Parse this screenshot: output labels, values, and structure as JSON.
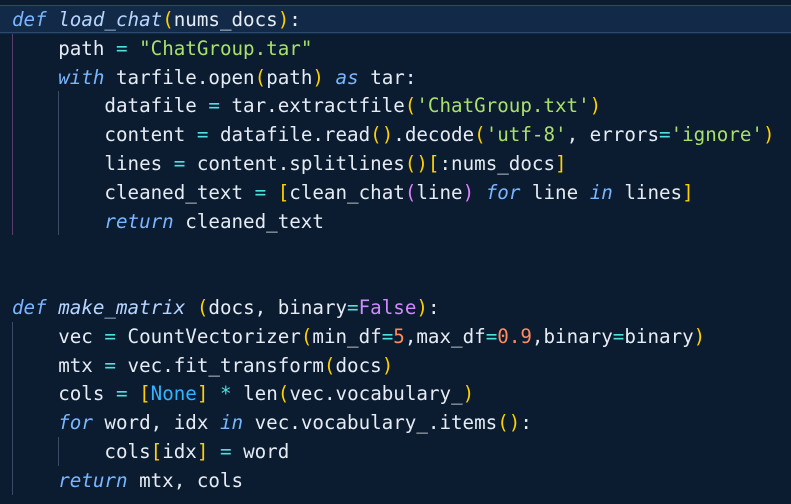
{
  "editor": {
    "colors": {
      "background": "#0b1b30",
      "keyword": "#7ab6ff",
      "string": "#a8e06b",
      "operator": "#4ee1e1",
      "number": "#ff8a5c",
      "constant": "#cf8aff",
      "bracket_yellow": "#ffd000",
      "bracket_purple": "#e080ff",
      "bracket_blue": "#33b4ff"
    },
    "lines": [
      [
        [
          "kw",
          "def"
        ],
        [
          "plain",
          " "
        ],
        [
          "fn",
          "load_chat"
        ],
        [
          "y",
          "("
        ],
        [
          "plain",
          "nums_docs"
        ],
        [
          "y",
          ")"
        ],
        [
          "punc",
          ":"
        ]
      ],
      [
        [
          "plain",
          "    path "
        ],
        [
          "op",
          "="
        ],
        [
          "plain",
          " "
        ],
        [
          "str",
          "\"ChatGroup.tar\""
        ]
      ],
      [
        [
          "plain",
          "    "
        ],
        [
          "kw",
          "with"
        ],
        [
          "plain",
          " tarfile.open"
        ],
        [
          "y",
          "("
        ],
        [
          "plain",
          "path"
        ],
        [
          "y",
          ")"
        ],
        [
          "plain",
          " "
        ],
        [
          "kw",
          "as"
        ],
        [
          "plain",
          " tar:"
        ]
      ],
      [
        [
          "plain",
          "        datafile "
        ],
        [
          "op",
          "="
        ],
        [
          "plain",
          " tar.extractfile"
        ],
        [
          "y",
          "("
        ],
        [
          "str",
          "'ChatGroup.txt'"
        ],
        [
          "y",
          ")"
        ]
      ],
      [
        [
          "plain",
          "        content "
        ],
        [
          "op",
          "="
        ],
        [
          "plain",
          " datafile.read"
        ],
        [
          "y",
          "("
        ],
        [
          "y",
          ")"
        ],
        [
          "plain",
          ".decode"
        ],
        [
          "y",
          "("
        ],
        [
          "str",
          "'utf-8'"
        ],
        [
          "plain",
          ", errors"
        ],
        [
          "op",
          "="
        ],
        [
          "str",
          "'ignore'"
        ],
        [
          "y",
          ")"
        ]
      ],
      [
        [
          "plain",
          "        lines "
        ],
        [
          "op",
          "="
        ],
        [
          "plain",
          " content.splitlines"
        ],
        [
          "y",
          "("
        ],
        [
          "y",
          ")"
        ],
        [
          "y",
          "["
        ],
        [
          "plain",
          ":nums_docs"
        ],
        [
          "y",
          "]"
        ]
      ],
      [
        [
          "plain",
          "        cleaned_text "
        ],
        [
          "op",
          "="
        ],
        [
          "plain",
          " "
        ],
        [
          "y",
          "["
        ],
        [
          "plain",
          "clean_chat"
        ],
        [
          "p",
          "("
        ],
        [
          "plain",
          "line"
        ],
        [
          "p",
          ")"
        ],
        [
          "plain",
          " "
        ],
        [
          "kw",
          "for"
        ],
        [
          "plain",
          " line "
        ],
        [
          "kw",
          "in"
        ],
        [
          "plain",
          " lines"
        ],
        [
          "y",
          "]"
        ]
      ],
      [
        [
          "plain",
          "        "
        ],
        [
          "kw",
          "return"
        ],
        [
          "plain",
          " cleaned_text"
        ]
      ],
      [],
      [],
      [
        [
          "kw",
          "def"
        ],
        [
          "plain",
          " "
        ],
        [
          "fn",
          "make_matrix"
        ],
        [
          "plain",
          " "
        ],
        [
          "y",
          "("
        ],
        [
          "plain",
          "docs, binary"
        ],
        [
          "op",
          "="
        ],
        [
          "const",
          "False"
        ],
        [
          "y",
          ")"
        ],
        [
          "punc",
          ":"
        ]
      ],
      [
        [
          "plain",
          "    vec "
        ],
        [
          "op",
          "="
        ],
        [
          "plain",
          " CountVectorizer"
        ],
        [
          "y",
          "("
        ],
        [
          "plain",
          "min_df"
        ],
        [
          "op",
          "="
        ],
        [
          "num",
          "5"
        ],
        [
          "plain",
          ",max_df"
        ],
        [
          "op",
          "="
        ],
        [
          "num",
          "0.9"
        ],
        [
          "plain",
          ",binary"
        ],
        [
          "op",
          "="
        ],
        [
          "plain",
          "binary"
        ],
        [
          "y",
          ")"
        ]
      ],
      [
        [
          "plain",
          "    mtx "
        ],
        [
          "op",
          "="
        ],
        [
          "plain",
          " vec.fit_transform"
        ],
        [
          "y",
          "("
        ],
        [
          "plain",
          "docs"
        ],
        [
          "y",
          ")"
        ]
      ],
      [
        [
          "plain",
          "    cols "
        ],
        [
          "op",
          "="
        ],
        [
          "plain",
          " "
        ],
        [
          "y",
          "["
        ],
        [
          "b",
          "None"
        ],
        [
          "y",
          "]"
        ],
        [
          "plain",
          " "
        ],
        [
          "op",
          "*"
        ],
        [
          "plain",
          " len"
        ],
        [
          "y",
          "("
        ],
        [
          "plain",
          "vec.vocabulary_"
        ],
        [
          "y",
          ")"
        ]
      ],
      [
        [
          "plain",
          "    "
        ],
        [
          "kw",
          "for"
        ],
        [
          "plain",
          " word, idx "
        ],
        [
          "kw",
          "in"
        ],
        [
          "plain",
          " vec.vocabulary_.items"
        ],
        [
          "y",
          "("
        ],
        [
          "y",
          ")"
        ],
        [
          "punc",
          ":"
        ]
      ],
      [
        [
          "plain",
          "        cols"
        ],
        [
          "y",
          "["
        ],
        [
          "plain",
          "idx"
        ],
        [
          "y",
          "]"
        ],
        [
          "plain",
          " "
        ],
        [
          "op",
          "="
        ],
        [
          "plain",
          " word"
        ]
      ],
      [
        [
          "plain",
          "    "
        ],
        [
          "kw",
          "return"
        ],
        [
          "plain",
          " mtx, cols"
        ]
      ]
    ]
  }
}
